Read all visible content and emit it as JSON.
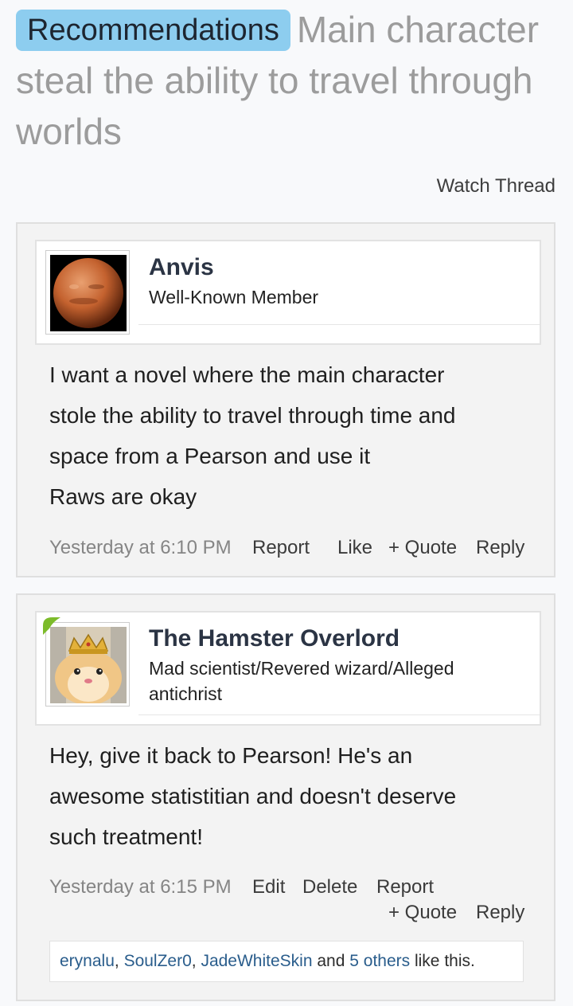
{
  "thread": {
    "prefix": "Recommendations",
    "title": "Main character steal the ability to travel through worlds",
    "watch_label": "Watch Thread"
  },
  "posts": [
    {
      "username": "Anvis",
      "user_title": "Well-Known Member",
      "avatar_icon": "mars-planet-avatar",
      "lines": [
        "I want a novel where the main character",
        "stole the ability to travel through time and",
        "space from a Pearson and use it",
        "Raws are okay"
      ],
      "timestamp": "Yesterday at 6:10 PM",
      "actions": {
        "report": "Report",
        "like": "Like",
        "quote": "+ Quote",
        "reply": "Reply"
      }
    },
    {
      "username": "The Hamster Overlord",
      "user_title_line1": "Mad scientist/Revered wizard/Alleged",
      "user_title_line2": "antichrist",
      "avatar_icon": "crowned-hamster-avatar",
      "lines": [
        "Hey, give it back to Pearson! He's an",
        "awesome statistitian and doesn't deserve",
        "such treatment!"
      ],
      "timestamp": "Yesterday at 6:15 PM",
      "actions": {
        "edit": "Edit",
        "delete": "Delete",
        "report": "Report",
        "quote": "+ Quote",
        "reply": "Reply"
      },
      "likes": {
        "names": [
          "erynalu",
          "SoulZer0",
          "JadeWhiteSkin"
        ],
        "sep1": ", ",
        "sep2": ", ",
        "and": " and ",
        "others": "5 others",
        "suffix": " like this."
      }
    }
  ],
  "colors": {
    "prefix_bg": "#8dcdef",
    "link": "#2a5d8c",
    "username": "#2b3444"
  }
}
